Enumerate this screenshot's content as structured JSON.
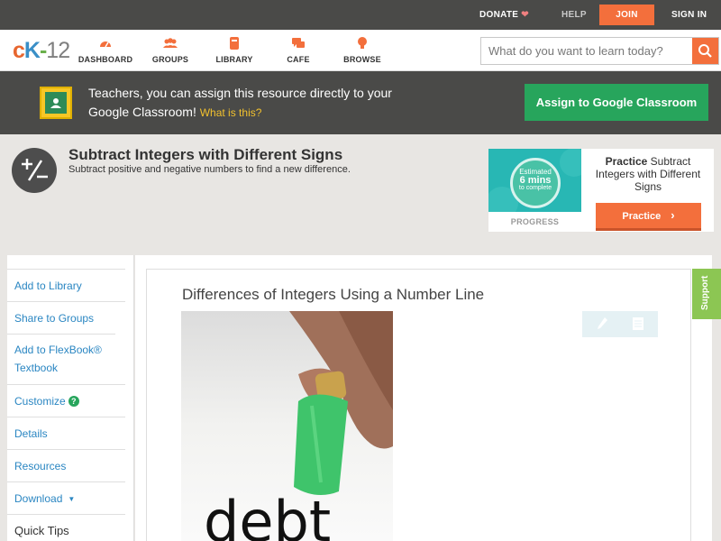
{
  "topbar": {
    "donate": "DONATE",
    "help": "HELP",
    "join": "JOIN",
    "signin": "SIGN IN"
  },
  "logo": {
    "c": "c",
    "k": "K",
    "dash": "-",
    "num": "12"
  },
  "nav": {
    "items": [
      {
        "label": "DASHBOARD",
        "icon": "gauge-icon"
      },
      {
        "label": "GROUPS",
        "icon": "group-icon"
      },
      {
        "label": "LIBRARY",
        "icon": "library-icon"
      },
      {
        "label": "CAFE",
        "icon": "chat-icon"
      },
      {
        "label": "BROWSE",
        "icon": "lightbulb-icon"
      }
    ],
    "search_placeholder": "What do you want to learn today?"
  },
  "banner": {
    "message": "Teachers, you can assign this resource directly to your Google Classroom!",
    "link": "What is this?",
    "button": "Assign to Google Classroom"
  },
  "header": {
    "title": "Subtract Integers with Different Signs",
    "subtitle": "Subtract positive and negative numbers to find a new difference."
  },
  "practice": {
    "estimated": "Estimated",
    "mins": "6 mins",
    "to_complete": "to complete",
    "progress": "PROGRESS",
    "title_bold": "Practice",
    "title_rest": "Subtract Integers with Different Signs",
    "button": "Practice"
  },
  "sidebar": {
    "items": [
      "Add to Library",
      "Share to Groups",
      "Add to FlexBook® Textbook",
      "Customize",
      "Details",
      "Resources",
      "Download",
      "Quick Tips"
    ]
  },
  "content": {
    "title": "Differences of Integers Using a Number Line",
    "support": "Support"
  },
  "colors": {
    "accent": "#f36f3c",
    "green": "#27a55c",
    "link": "#2a86c2",
    "dark": "#4a4a48"
  }
}
